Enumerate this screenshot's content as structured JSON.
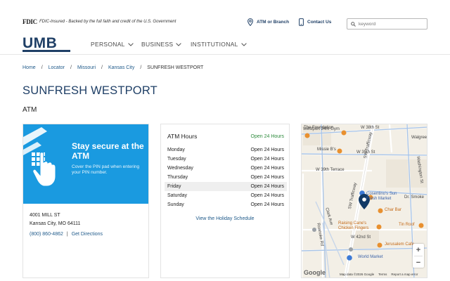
{
  "header": {
    "fdic_logo": "FDIC",
    "fdic_text": "FDIC-Insured - Backed by the full faith and credit of the U.S. Government",
    "atm_link": "ATM or Branch",
    "contact_link": "Contact Us",
    "search_placeholder": "keyword"
  },
  "nav": {
    "logo": "UMB",
    "items": [
      {
        "label": "PERSONAL"
      },
      {
        "label": "BUSINESS"
      },
      {
        "label": "INSTITUTIONAL"
      }
    ]
  },
  "breadcrumb": [
    {
      "label": "Home"
    },
    {
      "label": "Locator"
    },
    {
      "label": "Missouri"
    },
    {
      "label": "Kansas City"
    },
    {
      "label": "SUNFRESH WESTPORT"
    }
  ],
  "page": {
    "title": "SUNFRESH WESTPORT",
    "subtitle": "ATM"
  },
  "promo": {
    "title": "Stay secure at the ATM",
    "body": "Cover the PIN pad when entering your PIN number."
  },
  "location": {
    "address_line1": "4001 MILL ST",
    "address_line2": "Kansas City, MO 64111",
    "phone": "(800) 860-4862",
    "directions": "Get Directions"
  },
  "hours": {
    "title": "ATM Hours",
    "status": "Open 24 Hours",
    "rows": [
      {
        "day": "Monday",
        "time": "Open 24 Hours"
      },
      {
        "day": "Tuesday",
        "time": "Open 24 Hours"
      },
      {
        "day": "Wednesday",
        "time": "Open 24 Hours"
      },
      {
        "day": "Thursday",
        "time": "Open 24 Hours"
      },
      {
        "day": "Friday",
        "time": "Open 24 Hours"
      },
      {
        "day": "Saturday",
        "time": "Open 24 Hours"
      },
      {
        "day": "Sunday",
        "time": "Open 24 Hours"
      }
    ],
    "holiday_link": "View the Holiday Schedule"
  },
  "map": {
    "labels": {
      "foundation": "The Foundation",
      "gym": "Westport 24hr Gym",
      "w38": "W 38th St",
      "missie": "Missie B's",
      "w39": "W 39th St",
      "walgreens": "Walgree",
      "w39terrace": "W 39th Terrace",
      "trafficway1": "SW Trafficway",
      "trafficway2": "SW Trafficway",
      "cosentino": "Cosentino's Sun Fresh Market",
      "drsmoke": "Dr. Smoke",
      "clark": "Clark Ave",
      "charbar": "Char Bar",
      "washington": "Washington St",
      "tinroof": "Tin Roof",
      "raising": "Raising Cane's Chicken Fingers",
      "w42": "W 42nd St",
      "jerusalem": "Jerusalem Cafe",
      "roanoke": "Roanoke Rd",
      "worldmarket": "World Market"
    },
    "attribution": "Map data ©2026 Google",
    "terms": "Terms",
    "report": "Report a map error",
    "google": "Google",
    "zoom_in": "+",
    "zoom_out": "−"
  }
}
